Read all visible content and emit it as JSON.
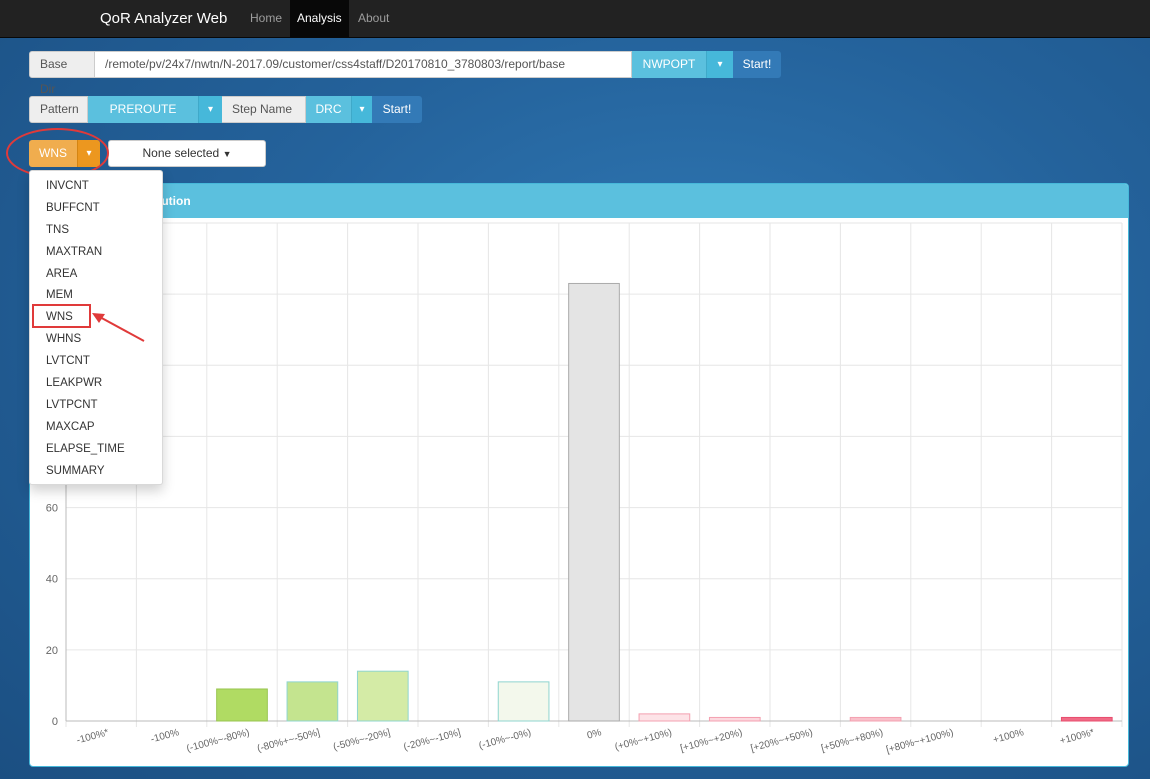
{
  "nav": {
    "brand": "QoR Analyzer Web",
    "links": [
      "Home",
      "Analysis",
      "About"
    ]
  },
  "base_row": {
    "label": "Base Dir",
    "path": "/remote/pv/24x7/nwtn/N-2017.09/customer/css4staff/D20170810_3780803/report/base",
    "selector": "NWPOPT",
    "start": "Start!"
  },
  "pattern_row": {
    "pattern_label": "Pattern",
    "pattern_value": "PREROUTE",
    "step_label": "Step Name",
    "step_value": "DRC",
    "start": "Start!"
  },
  "metric_row": {
    "metric": "WNS",
    "filter": "None selected"
  },
  "dropdown": {
    "items": [
      "INVCNT",
      "BUFFCNT",
      "TNS",
      "MAXTRAN",
      "AREA",
      "MEM",
      "WNS",
      "WHNS",
      "LVTCNT",
      "LEAKPWR",
      "LVTPCNT",
      "MAXCAP",
      "ELAPSE_TIME",
      "SUMMARY"
    ],
    "highlighted": "WNS"
  },
  "panel": {
    "title_visible": "ribution"
  },
  "chart_data": {
    "type": "bar",
    "categories": [
      "-100%*",
      "-100%",
      "(-100%~-80%)",
      "(-80%+~-50%]",
      "(-50%~-20%]",
      "(-20%~-10%]",
      "(-10%~-0%)",
      "0%",
      "(+0%~+10%)",
      "[+10%~+20%)",
      "[+20%~+50%)",
      "[+50%~+80%)",
      "[+80%~+100%)",
      "+100%",
      "+100%*"
    ],
    "values": [
      0,
      0,
      9,
      11,
      14,
      0,
      11,
      123,
      2,
      1,
      0,
      1,
      0,
      0,
      1
    ],
    "ylim": [
      0,
      140
    ],
    "yticks_visible": [
      0,
      20,
      40,
      60
    ],
    "grid": true,
    "colors": {
      "fills": [
        "#f0f0f0",
        "#f0f0f0",
        "#b0db63",
        "#c4e48f",
        "#d4eba6",
        "#f0f0f0",
        "#f3f8ec",
        "#e4e4e4",
        "#fde3e7",
        "#fcd9df",
        "#f0f0f0",
        "#f9c0ca",
        "#f0f0f0",
        "#f0f0f0",
        "#f06b86"
      ],
      "strokes": [
        "#cccccc",
        "#cccccc",
        "#98c550",
        "#8fd5cf",
        "#8fd5cf",
        "#cccccc",
        "#8fd5cf",
        "#aaaaaa",
        "#f3a0b0",
        "#f3a0b0",
        "#cccccc",
        "#f3a0b0",
        "#cccccc",
        "#cccccc",
        "#e84d6e"
      ]
    }
  }
}
